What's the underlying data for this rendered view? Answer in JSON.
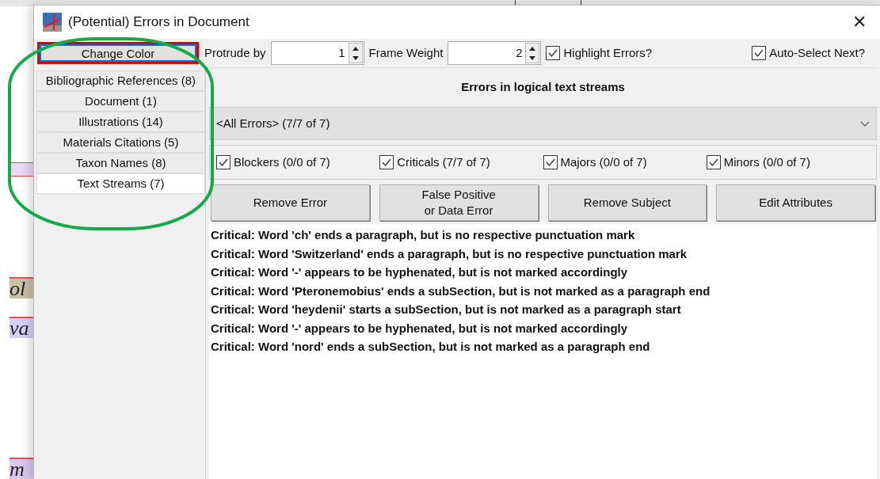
{
  "background_document": {
    "fragments": [
      "ol",
      "va",
      "m"
    ]
  },
  "window": {
    "title": "(Potential) Errors in Document",
    "close": "✕"
  },
  "toolbar": {
    "change_color_button": "Change Color",
    "spinners": [
      {
        "label": "Protrude by",
        "value": "1"
      },
      {
        "label": "Frame Weight",
        "value": "2"
      }
    ],
    "checkboxes": [
      {
        "label": "Highlight Errors?",
        "checked": true
      },
      {
        "label": "Auto-Select Next?",
        "checked": true
      }
    ]
  },
  "sidebar": {
    "items": [
      {
        "label": "Bibliographic References (8)",
        "selected": false
      },
      {
        "label": "Document (1)",
        "selected": false
      },
      {
        "label": "Illustrations (14)",
        "selected": false
      },
      {
        "label": "Materials Citations (5)",
        "selected": false
      },
      {
        "label": "Taxon Names (8)",
        "selected": false
      },
      {
        "label": "Text Streams (7)",
        "selected": true
      }
    ]
  },
  "panel": {
    "heading": "Errors in logical text streams",
    "filter": {
      "value": "<All Errors> (7/7 of 7)"
    },
    "severity_checkboxes": [
      {
        "label": "Blockers (0/0 of 7)",
        "checked": true
      },
      {
        "label": "Criticals (7/7 of 7)",
        "checked": true
      },
      {
        "label": "Majors (0/0 of 7)",
        "checked": true
      },
      {
        "label": "Minors (0/0 of 7)",
        "checked": true
      }
    ],
    "buttons": [
      "Remove Error",
      "False Positive\nor Data Error",
      "Remove Subject",
      "Edit Attributes"
    ],
    "errors": [
      "Critical: Word 'ch' ends a paragraph, but is no respective punctuation mark",
      "Critical: Word 'Switzerland' ends a paragraph, but is no respective punctuation mark",
      "Critical: Word '-' appears to be hyphenated, but is not marked accordingly",
      "Critical: Word 'Pteronemobius' ends a subSection, but is not marked as a paragraph end",
      "Critical: Word 'heydenii' starts a subSection, but is not marked as a paragraph start",
      "Critical: Word '-' appears to be hyphenated, but is not marked accordingly",
      "Critical: Word 'nord' ends a subSection, but is not marked as a paragraph end"
    ]
  },
  "annotations": {
    "highlight_box": true,
    "circle": true
  }
}
